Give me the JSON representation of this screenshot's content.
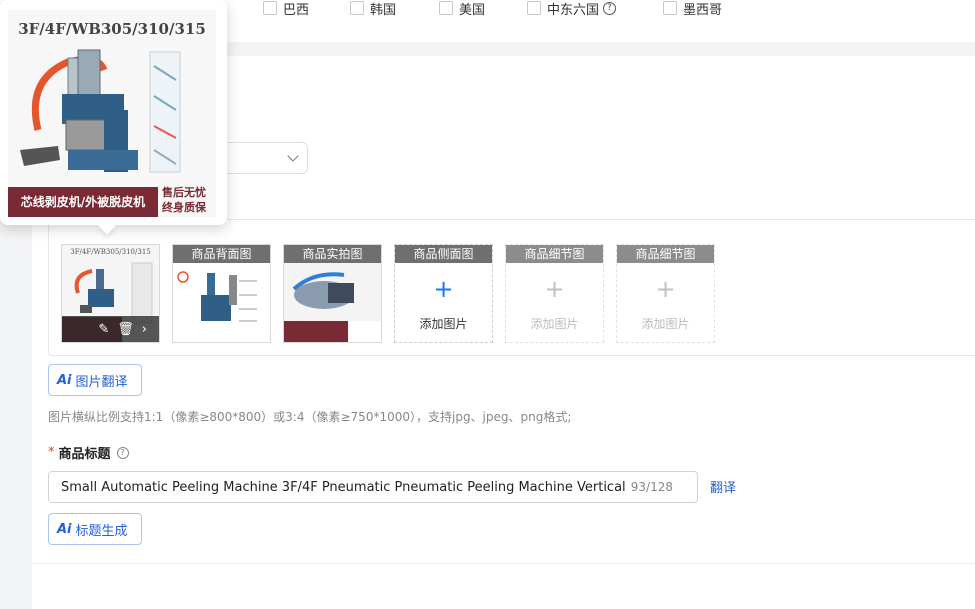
{
  "countries": [
    {
      "label": "巴西",
      "checked": false
    },
    {
      "label": "韩国",
      "checked": false
    },
    {
      "label": "美国",
      "checked": false
    },
    {
      "label": "中东六国",
      "checked": false,
      "help": true
    },
    {
      "label": "墨西哥",
      "checked": false
    }
  ],
  "popover": {
    "model_text": "3F/4F/WB305/310/315",
    "banner_text": "芯线剥皮机/外被脱皮机",
    "warranty_text": "售后无忧 终身质保"
  },
  "images": {
    "first_thumb_model": "3F/4F/WB305/310/315",
    "slots": [
      {
        "tag": "商品背面图",
        "filled": true
      },
      {
        "tag": "商品实拍图",
        "filled": true
      },
      {
        "tag": "商品侧面图",
        "filled": false,
        "enabled": true,
        "add_label": "添加图片"
      },
      {
        "tag": "商品细节图",
        "filled": false,
        "enabled": false,
        "add_label": "添加图片"
      },
      {
        "tag": "商品细节图",
        "filled": false,
        "enabled": false,
        "add_label": "添加图片"
      }
    ]
  },
  "buttons": {
    "image_translate": "图片翻译",
    "title_generate": "标题生成",
    "translate_link": "翻译"
  },
  "hint": "图片横纵比例支持1:1（像素≥800*800）或3:4（像素≥750*1000），支持jpg、jpeg、png格式;",
  "product_title": {
    "label": "商品标题",
    "value": "Small Automatic Peeling Machine 3F/4F Pneumatic Pneumatic Peeling Machine Vertical Horizontal",
    "counter": "93/128"
  },
  "colors": {
    "accent": "#2460d6",
    "required": "#e53935",
    "banner": "#7a2a34"
  }
}
